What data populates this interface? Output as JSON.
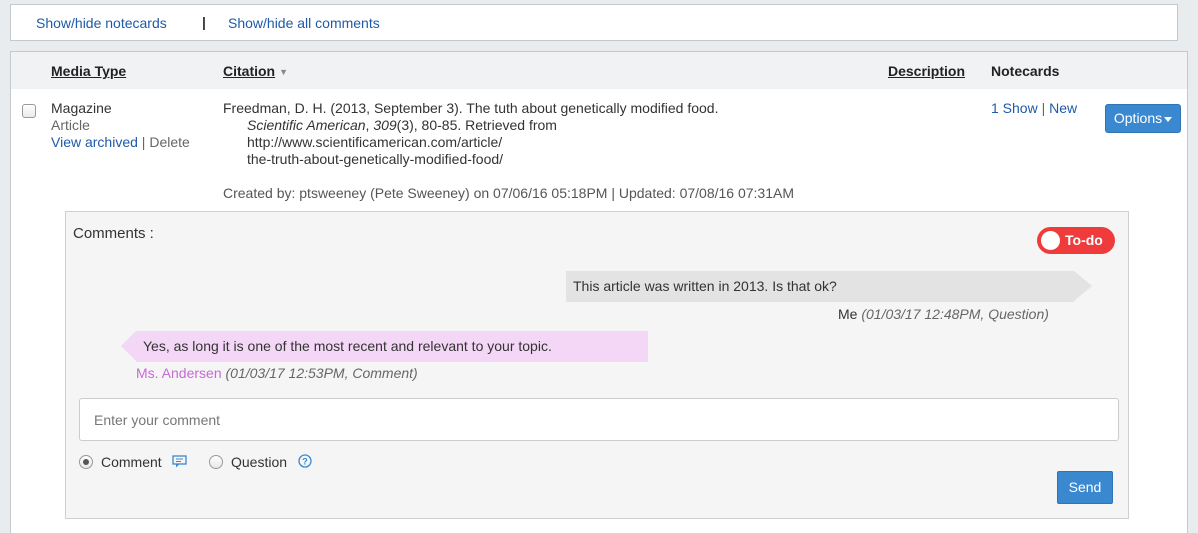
{
  "toolbar": {
    "notecards_toggle": "Show/hide notecards",
    "separator": "|",
    "comments_toggle": "Show/hide all comments"
  },
  "table": {
    "headers": {
      "media_type": "Media Type",
      "citation": "Citation",
      "description": "Description",
      "notecards": "Notecards"
    }
  },
  "row": {
    "media_type": "Magazine",
    "media_subtype": "Article",
    "view_archived": "View archived",
    "sep": "|",
    "delete": "Delete",
    "citation": {
      "line1": "Freedman, D. H. (2013, September 3). The tuth about genetically modified food.",
      "journal": "Scientific American",
      "comma1": ", ",
      "volume": "309",
      "rest": "(3), 80-85. Retrieved from",
      "url1": "http://www.scientificamerican.com/article/",
      "url2": "the-truth-about-genetically-modified-food/"
    },
    "created": "Created by: ptsweeney (Pete Sweeney) on 07/06/16 05:18PM | Updated: 07/08/16 07:31AM",
    "notecards": {
      "show": "1 Show",
      "sep": "|",
      "new": "New"
    },
    "options": "Options"
  },
  "comments": {
    "title": "Comments :",
    "todo_label": "To-do",
    "messages": [
      {
        "text": "This article was written in 2013. Is that ok?",
        "author": "Me",
        "meta": "(01/03/17 12:48PM, Question)"
      },
      {
        "text": "Yes, as long it is one of the most recent and relevant to your topic.",
        "author": "Ms. Andersen",
        "meta": "(01/03/17 12:53PM, Comment)"
      }
    ],
    "input_placeholder": "Enter your comment",
    "type_options": [
      "Comment",
      "Question"
    ],
    "selected_type": "Comment",
    "send": "Send"
  },
  "colors": {
    "link": "#1f5aa8",
    "button": "#3a88d0",
    "todo": "#ef3b3b",
    "my_bubble": "#e3e3e3",
    "their_bubble": "#f4d6f6",
    "their_name": "#c56bd6"
  }
}
